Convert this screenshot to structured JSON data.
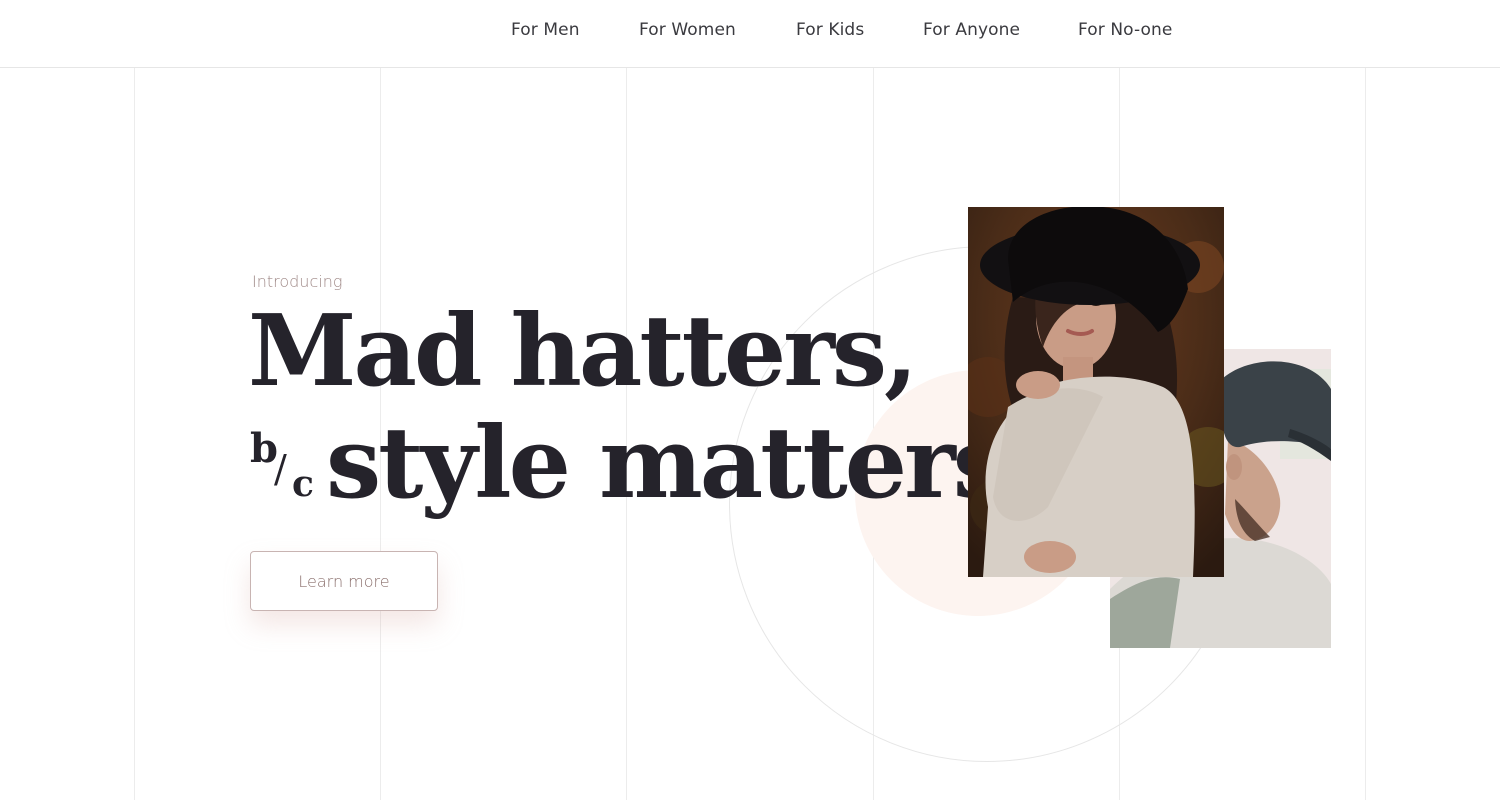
{
  "nav": {
    "items": [
      {
        "label": "For Men"
      },
      {
        "label": "For Women"
      },
      {
        "label": "For Kids"
      },
      {
        "label": "For Anyone"
      },
      {
        "label": "For No-one"
      }
    ]
  },
  "hero": {
    "eyebrow": "Introducing",
    "headline_line1": "Mad hatters,",
    "headline_prefix_b": "b",
    "headline_prefix_slash": "/",
    "headline_prefix_c": "c",
    "headline_line2": "style matters",
    "cta_label": "Learn more"
  },
  "colors": {
    "text": "#25232b",
    "accent": "#8a6f6c",
    "blush": "#fdf4f0",
    "grid": "#ececec"
  },
  "images": {
    "photo_woman": "woman-in-black-hat-photo",
    "photo_man": "man-in-black-cap-photo"
  }
}
